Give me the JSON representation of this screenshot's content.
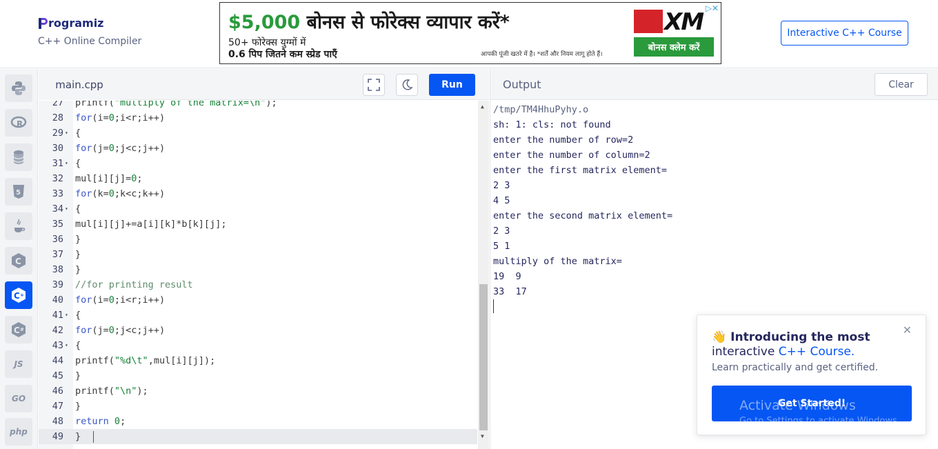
{
  "header": {
    "logo_text": "rogramiz",
    "logo_subtitle": "C++ Online Compiler",
    "course_button": "Interactive C++ Course"
  },
  "ad": {
    "headline_amount": "$5,000",
    "headline_rest": " बोनस से फोरेक्स व्यापार करें*",
    "line1": "50+ फोरेक्स युग्मों में",
    "line2": "0.6 पिप जितने कम स्प्रेड पाएँ",
    "disclaimer": "आपकी पूंजी खतरे में है। *शर्तें और नियम लागू होते हैं।",
    "brand": "XM",
    "cta": "बोनस क्लेम करें",
    "choices": "▷✕"
  },
  "sidebar": {
    "items": [
      {
        "name": "python",
        "icon": "python-icon"
      },
      {
        "name": "r",
        "icon": "r-icon"
      },
      {
        "name": "sql",
        "icon": "database-icon"
      },
      {
        "name": "html",
        "icon": "html5-icon"
      },
      {
        "name": "java",
        "icon": "java-icon"
      },
      {
        "name": "c",
        "icon": "c-icon"
      },
      {
        "name": "cpp",
        "icon": "cpp-icon",
        "active": true
      },
      {
        "name": "csharp",
        "icon": "csharp-icon"
      },
      {
        "name": "js",
        "label": "JS"
      },
      {
        "name": "go",
        "label": "GO"
      },
      {
        "name": "php",
        "label": "php"
      }
    ]
  },
  "editor": {
    "file_name": "main.cpp",
    "run_label": "Run",
    "lines": [
      {
        "n": "27",
        "text": "printf(\"multiply of the matrix=\\n\");"
      },
      {
        "n": "28",
        "text": "for(i=0;i<r;i++)"
      },
      {
        "n": "29",
        "text": "{",
        "fold": true
      },
      {
        "n": "30",
        "text": "for(j=0;j<c;j++)"
      },
      {
        "n": "31",
        "text": "{",
        "fold": true
      },
      {
        "n": "32",
        "text": "mul[i][j]=0;"
      },
      {
        "n": "33",
        "text": "for(k=0;k<c;k++)"
      },
      {
        "n": "34",
        "text": "{",
        "fold": true
      },
      {
        "n": "35",
        "text": "mul[i][j]+=a[i][k]*b[k][j];"
      },
      {
        "n": "36",
        "text": "}"
      },
      {
        "n": "37",
        "text": "}"
      },
      {
        "n": "38",
        "text": "}"
      },
      {
        "n": "39",
        "text": "//for printing result"
      },
      {
        "n": "40",
        "text": "for(i=0;i<r;i++)"
      },
      {
        "n": "41",
        "text": "{",
        "fold": true
      },
      {
        "n": "42",
        "text": "for(j=0;j<c;j++)"
      },
      {
        "n": "43",
        "text": "{",
        "fold": true
      },
      {
        "n": "44",
        "text": "printf(\"%d\\t\",mul[i][j]);"
      },
      {
        "n": "45",
        "text": "}"
      },
      {
        "n": "46",
        "text": "printf(\"\\n\");"
      },
      {
        "n": "47",
        "text": "}"
      },
      {
        "n": "48",
        "text": "return 0;"
      },
      {
        "n": "49",
        "text": "}",
        "active": true
      }
    ]
  },
  "output": {
    "title": "Output",
    "clear_label": "Clear",
    "lines": [
      "/tmp/TM4HhuPyhy.o",
      "sh: 1: cls: not found",
      "enter the number of row=2",
      "enter the number of column=2",
      "enter the first matrix element=",
      "2 3",
      "4 5",
      "enter the second matrix element=",
      "2 3",
      "5 1",
      "multiply of the matrix=",
      "19  9",
      "33  17"
    ]
  },
  "popup": {
    "emoji": "👋",
    "title_line1": "Introducing the most",
    "title_line2_prefix": "interactive ",
    "title_line2_highlight": "C++ Course.",
    "subtitle": "Learn practically and get certified.",
    "button": "Get Started!",
    "close": "✕"
  },
  "watermark": {
    "line1": "Activate Windows",
    "line2": "Go to Settings to activate Windows."
  },
  "colors": {
    "accent": "#0556f3",
    "ad_green": "#2a9a3c",
    "ad_red": "#d5232a"
  }
}
